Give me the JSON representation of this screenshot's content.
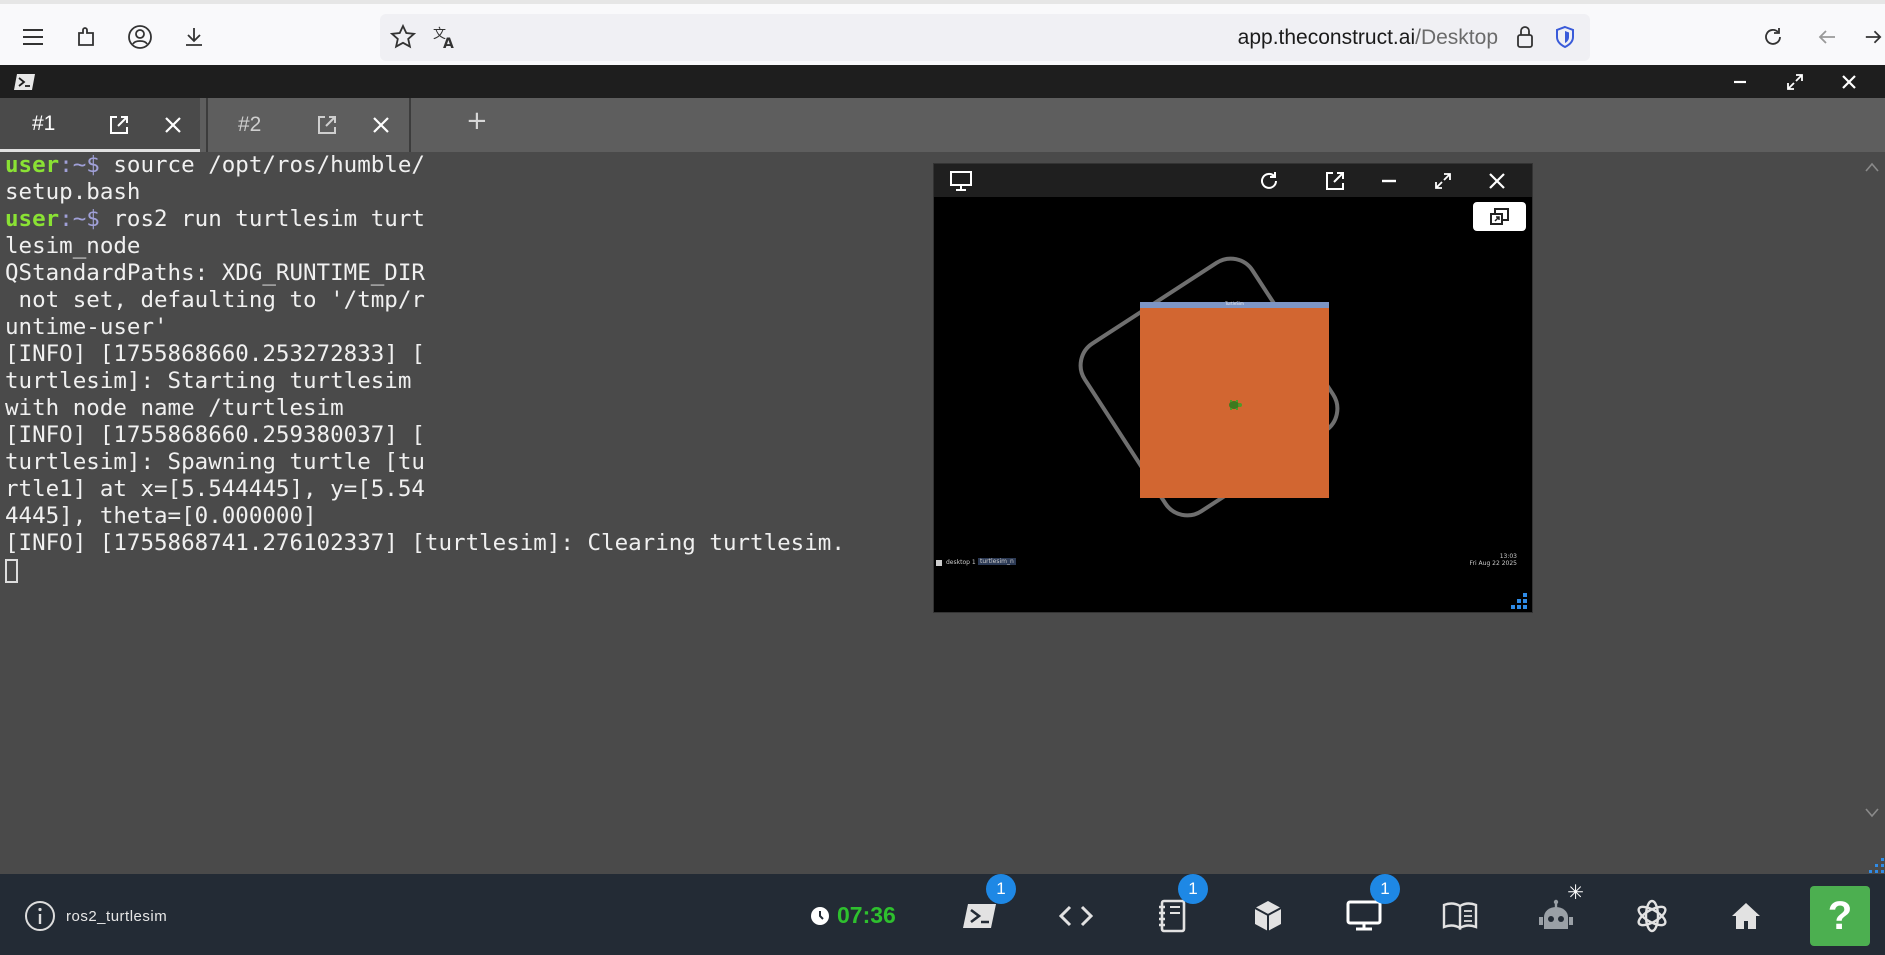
{
  "browser": {
    "url_domain": "app.theconstruct.ai",
    "url_path": "/Desktop"
  },
  "tabs": [
    {
      "label": "#1",
      "active": true
    },
    {
      "label": "#2",
      "active": false
    }
  ],
  "tab_add_label": "+",
  "terminal": {
    "prompt_user": "user",
    "prompt_path": ":~$",
    "lines": [
      {
        "type": "prompt",
        "text": " source /opt/ros/humble/"
      },
      {
        "type": "out",
        "text": "setup.bash"
      },
      {
        "type": "prompt",
        "text": " ros2 run turtlesim turt"
      },
      {
        "type": "out",
        "text": "lesim_node"
      },
      {
        "type": "out",
        "text": "QStandardPaths: XDG_RUNTIME_DIR"
      },
      {
        "type": "out",
        "text": " not set, defaulting to '/tmp/r"
      },
      {
        "type": "out",
        "text": "untime-user'"
      },
      {
        "type": "out",
        "text": "[INFO] [1755868660.253272833] ["
      },
      {
        "type": "out",
        "text": "turtlesim]: Starting turtlesim"
      },
      {
        "type": "out",
        "text": "with node name /turtlesim"
      },
      {
        "type": "out",
        "text": "[INFO] [1755868660.259380037] ["
      },
      {
        "type": "out",
        "text": "turtlesim]: Spawning turtle [tu"
      },
      {
        "type": "out",
        "text": "rtle1] at x=[5.544445], y=[5.54"
      },
      {
        "type": "out",
        "text": "4445], theta=[0.000000]"
      },
      {
        "type": "out",
        "text": "[INFO] [1755868741.276102337] [turtlesim]: Clearing turtlesim."
      }
    ]
  },
  "viewer": {
    "turtlesim_title": "TurtleSim",
    "mini_taskbar": "desktop 1",
    "mini_task": "turtlesim_n",
    "mini_clock_time": "13:03",
    "mini_clock_date": "Fri Aug 22 2025"
  },
  "bottom": {
    "project_name": "ros2_turtlesim",
    "timer": "07:36",
    "badges": {
      "terminal": "1",
      "notebook": "1",
      "desktop": "1"
    },
    "help_label": "?"
  },
  "colors": {
    "accent_green": "#2ec02e",
    "badge_blue": "#1e88e5",
    "turtlesim_bg": "#d26631"
  }
}
